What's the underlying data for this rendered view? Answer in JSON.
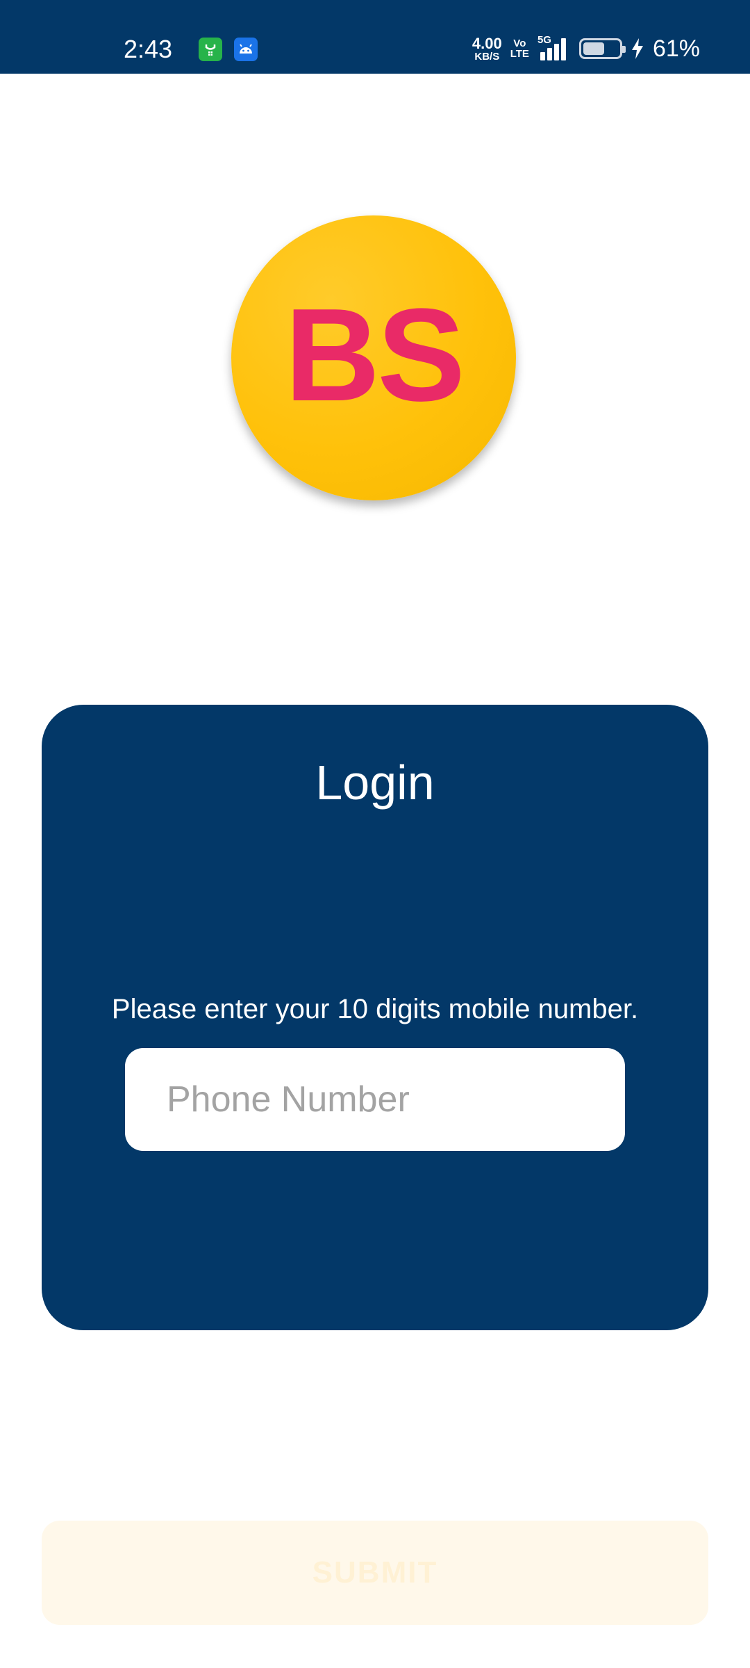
{
  "status_bar": {
    "time": "2:43",
    "notification_icons": [
      "shopping-bag-icon",
      "android-icon"
    ],
    "net_speed_value": "4.00",
    "net_speed_unit": "KB/S",
    "volte_top": "Vo",
    "volte_bottom": "LTE",
    "network_type": "5G",
    "battery_level": 0.61,
    "battery_percent": "61%",
    "charging": true
  },
  "logo": {
    "text": "BS",
    "background_color": "#ffc10a",
    "text_color": "#e92a67"
  },
  "login_card": {
    "title": "Login",
    "hint": "Please enter your 10 digits mobile number.",
    "phone_input": {
      "placeholder": "Phone Number",
      "value": ""
    },
    "background_color": "#033868"
  },
  "submit": {
    "label": "SUBMIT",
    "enabled": false
  }
}
